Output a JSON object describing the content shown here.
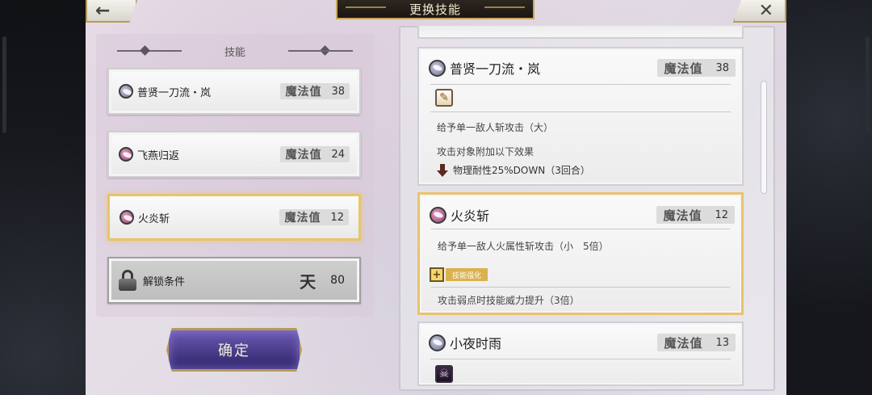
{
  "header": {
    "title": "更换技能",
    "back_icon": "←",
    "close_icon": "✕"
  },
  "left": {
    "section_title": "技能",
    "slots": [
      {
        "name": "普贤一刀流・岚",
        "mp_label": "魔法值",
        "mp": "38",
        "orb": "blue"
      },
      {
        "name": "飞燕归返",
        "mp_label": "魔法值",
        "mp": "24",
        "orb": "pink"
      },
      {
        "name": "火炎斩",
        "mp_label": "魔法值",
        "mp": "12",
        "orb": "pink"
      }
    ],
    "locked": {
      "label": "解锁条件",
      "rank_glyph": "天",
      "value": "80"
    },
    "confirm_label": "确定"
  },
  "right": {
    "cards": [
      {
        "title": "普贤一刀流・岚",
        "mp_label": "魔法值",
        "mp": "38",
        "orb": "blue",
        "type_icon": "sword-icon",
        "type_glyph": "✎",
        "desc1": "给予单一敌人斩攻击（大）",
        "desc2": "攻击对象附加以下效果",
        "debuff": "物理耐性25%DOWN（3回合）"
      },
      {
        "title": "火炎斩",
        "mp_label": "魔法值",
        "mp": "12",
        "orb": "pink",
        "desc1": "给予单一敌人火属性斩攻击（小　5倍）",
        "enhance_plus": "+",
        "enhance_tag": "技能强化",
        "enhance_desc": "攻击弱点时技能威力提升（3倍）"
      },
      {
        "title": "小夜时雨",
        "mp_label": "魔法值",
        "mp": "13",
        "orb": "blue",
        "type_icon": "skull-icon",
        "type_glyph": "☠"
      }
    ]
  },
  "colors": {
    "gold_border": "#e8c46b",
    "confirm_purple": "#4a3c8f",
    "title_plate": "#1f1a15"
  }
}
